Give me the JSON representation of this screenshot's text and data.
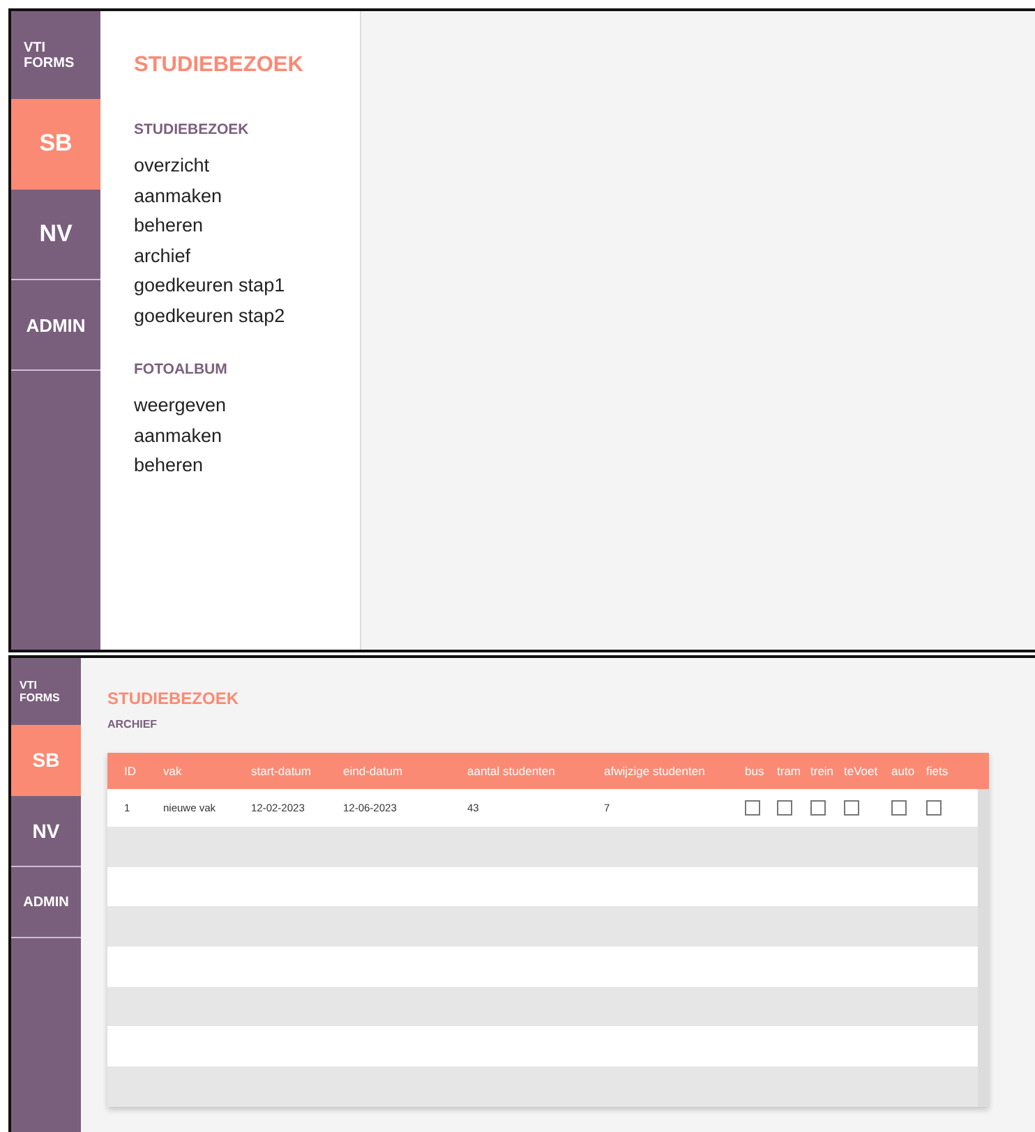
{
  "screens": [
    {
      "kind": "menu",
      "sidebar": {
        "brand": "VTI FORMS",
        "items": [
          {
            "label": "SB",
            "selected": true
          },
          {
            "label": "NV",
            "selected": false
          },
          {
            "label": "ADMIN",
            "selected": false
          }
        ]
      },
      "menu": {
        "title": "STUDIEBEZOEK",
        "sections": [
          {
            "heading": "STUDIEBEZOEK",
            "items": [
              "overzicht",
              "aanmaken",
              "beheren",
              "archief",
              "goedkeuren stap1",
              "goedkeuren stap2"
            ]
          },
          {
            "heading": "FOTOALBUM",
            "items": [
              "weergeven",
              "aanmaken",
              "beheren"
            ]
          }
        ]
      }
    },
    {
      "kind": "table",
      "sidebar": {
        "brand": "VTI FORMS",
        "items": [
          {
            "label": "SB",
            "selected": true
          },
          {
            "label": "NV",
            "selected": false
          },
          {
            "label": "ADMIN",
            "selected": false
          }
        ]
      },
      "title": "STUDIEBEZOEK",
      "subtitle": "ARCHIEF",
      "table": {
        "columns": [
          "ID",
          "vak",
          "start-datum",
          "eind-datum",
          "aantal studenten",
          "afwijzige studenten",
          "bus",
          "tram",
          "trein",
          "teVoet",
          "auto",
          "fiets"
        ],
        "rows": [
          {
            "cells": [
              "1",
              "nieuwe vak",
              "12-02-2023",
              "12-06-2023",
              "43",
              "7"
            ],
            "transport": [
              {
                "checked": false
              },
              {
                "checked": false
              },
              {
                "checked": false
              },
              {
                "checked": false
              },
              {
                "checked": false
              },
              {
                "checked": false
              }
            ]
          }
        ]
      }
    }
  ]
}
